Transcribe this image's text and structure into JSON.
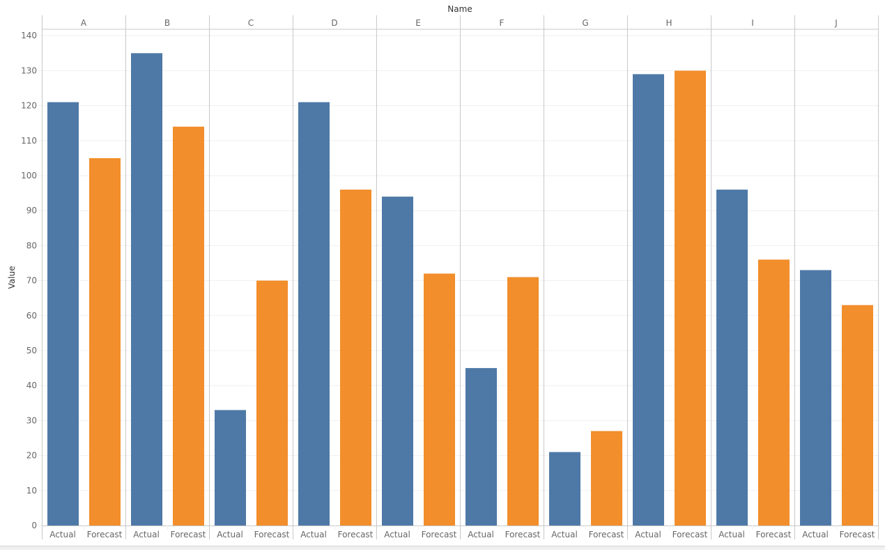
{
  "chart_data": {
    "type": "bar",
    "title": "",
    "column_header_title": "Name",
    "ylabel": "Value",
    "xlabel": "",
    "ylim": [
      0,
      142
    ],
    "y_ticks": [
      0,
      10,
      20,
      30,
      40,
      50,
      60,
      70,
      80,
      90,
      100,
      110,
      120,
      130,
      140
    ],
    "grid": true,
    "legend": "none",
    "categories": [
      "A",
      "B",
      "C",
      "D",
      "E",
      "F",
      "G",
      "H",
      "I",
      "J"
    ],
    "sub_categories": [
      "Actual",
      "Forecast"
    ],
    "series": [
      {
        "name": "Actual",
        "color": "#4e79a7",
        "values": [
          121,
          135,
          33,
          121,
          94,
          45,
          21,
          129,
          96,
          73
        ]
      },
      {
        "name": "Forecast",
        "color": "#f28e2b",
        "values": [
          105,
          114,
          70,
          96,
          72,
          71,
          27,
          130,
          76,
          63
        ]
      }
    ]
  },
  "colors": {
    "axis_text": "#666666",
    "title_text": "#333333",
    "divider": "#c8c8c8",
    "gridline": "#efefef"
  }
}
